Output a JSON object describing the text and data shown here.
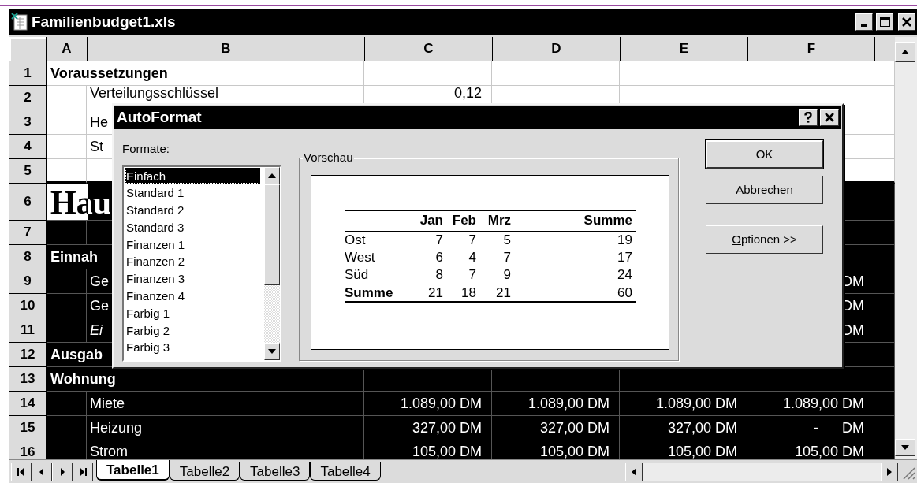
{
  "window": {
    "title": "Familienbudget1.xls"
  },
  "columns": [
    "A",
    "B",
    "C",
    "D",
    "E",
    "F"
  ],
  "rows": [
    {
      "number": "1",
      "dark": false,
      "cells": {
        "a": {
          "text": "Voraussetzungen",
          "kind": "heading"
        }
      }
    },
    {
      "number": "2",
      "dark": false,
      "cells": {
        "b": {
          "text": "Verteilungsschlüssel",
          "kind": "label"
        },
        "c": {
          "text": "0,12",
          "kind": "number"
        }
      }
    },
    {
      "number": "3",
      "dark": false,
      "cells": {
        "b": {
          "text": "He",
          "kind": "label"
        }
      }
    },
    {
      "number": "4",
      "dark": false,
      "cells": {
        "b": {
          "text": "St",
          "kind": "label"
        }
      }
    },
    {
      "number": "5",
      "dark": false,
      "cells": {}
    },
    {
      "number": "6",
      "dark": true,
      "cells": {
        "a": {
          "text": "Hau",
          "kind": "title"
        }
      }
    },
    {
      "number": "7",
      "dark": true,
      "cells": {}
    },
    {
      "number": "8",
      "dark": true,
      "cells": {
        "a": {
          "text": "Einnah",
          "kind": "heading"
        }
      }
    },
    {
      "number": "9",
      "dark": true,
      "cells": {
        "b": {
          "text": "Ge",
          "kind": "label"
        },
        "f": {
          "text": "DM",
          "kind": "number"
        }
      }
    },
    {
      "number": "10",
      "dark": true,
      "cells": {
        "b": {
          "text": "Ge",
          "kind": "label"
        },
        "f": {
          "text": "DM",
          "kind": "number"
        }
      }
    },
    {
      "number": "11",
      "dark": true,
      "cells": {
        "b": {
          "text": "Ei",
          "kind": "italic"
        },
        "f": {
          "text": "DM",
          "kind": "number"
        }
      }
    },
    {
      "number": "12",
      "dark": true,
      "cells": {
        "a": {
          "text": "Ausgab",
          "kind": "heading"
        }
      }
    },
    {
      "number": "13",
      "dark": true,
      "cells": {
        "a": {
          "text": "Wohnung",
          "kind": "heading"
        }
      }
    },
    {
      "number": "14",
      "dark": true,
      "cells": {
        "b": {
          "text": "Miete",
          "kind": "label"
        },
        "c": {
          "text": "1.089,00 DM",
          "kind": "number"
        },
        "d": {
          "text": "1.089,00 DM",
          "kind": "number"
        },
        "e": {
          "text": "1.089,00 DM",
          "kind": "number"
        },
        "f": {
          "text": "1.089,00 DM",
          "kind": "number"
        }
      }
    },
    {
      "number": "15",
      "dark": true,
      "cells": {
        "b": {
          "text": "Heizung",
          "kind": "label"
        },
        "c": {
          "text": "327,00 DM",
          "kind": "number"
        },
        "d": {
          "text": "327,00 DM",
          "kind": "number"
        },
        "e": {
          "text": "327,00 DM",
          "kind": "number"
        },
        "f": {
          "text": "-      DM",
          "kind": "number"
        }
      }
    },
    {
      "number": "16",
      "dark": true,
      "cells": {
        "b": {
          "text": "Strom",
          "kind": "label"
        },
        "c": {
          "text": "105,00 DM",
          "kind": "number"
        },
        "d": {
          "text": "105,00 DM",
          "kind": "number"
        },
        "e": {
          "text": "105,00 DM",
          "kind": "number"
        },
        "f": {
          "text": "105,00 DM",
          "kind": "number"
        }
      }
    }
  ],
  "sheet_tabs": [
    {
      "label": "Tabelle1",
      "selected": true
    },
    {
      "label": "Tabelle2",
      "selected": false
    },
    {
      "label": "Tabelle3",
      "selected": false
    },
    {
      "label": "Tabelle4",
      "selected": false
    }
  ],
  "dialog": {
    "title": "AutoFormat",
    "formats_label": {
      "mnemonic": "F",
      "rest": "ormate:"
    },
    "formats": [
      {
        "label": "Einfach",
        "selected": true
      },
      {
        "label": "Standard 1",
        "selected": false
      },
      {
        "label": "Standard 2",
        "selected": false
      },
      {
        "label": "Standard 3",
        "selected": false
      },
      {
        "label": "Finanzen 1",
        "selected": false
      },
      {
        "label": "Finanzen 2",
        "selected": false
      },
      {
        "label": "Finanzen 3",
        "selected": false
      },
      {
        "label": "Finanzen 4",
        "selected": false
      },
      {
        "label": "Farbig 1",
        "selected": false
      },
      {
        "label": "Farbig 2",
        "selected": false
      },
      {
        "label": "Farbig 3",
        "selected": false
      }
    ],
    "preview": {
      "title": "Vorschau",
      "columns": [
        "Jan",
        "Feb",
        "Mrz",
        "Summe"
      ],
      "rows": [
        {
          "label": "Ost",
          "values": [
            "7",
            "7",
            "5",
            "19"
          ],
          "kind": "data"
        },
        {
          "label": "West",
          "values": [
            "6",
            "4",
            "7",
            "17"
          ],
          "kind": "data"
        },
        {
          "label": "Süd",
          "values": [
            "8",
            "7",
            "9",
            "24"
          ],
          "kind": "data"
        },
        {
          "label": "Summe",
          "values": [
            "21",
            "18",
            "21",
            "60"
          ],
          "kind": "total"
        }
      ]
    },
    "buttons": [
      {
        "label": "OK",
        "default": true
      },
      {
        "label": "Abbrechen",
        "default": false
      },
      {
        "mnemonic": "O",
        "rest": "ptionen >>",
        "default": false
      }
    ]
  }
}
